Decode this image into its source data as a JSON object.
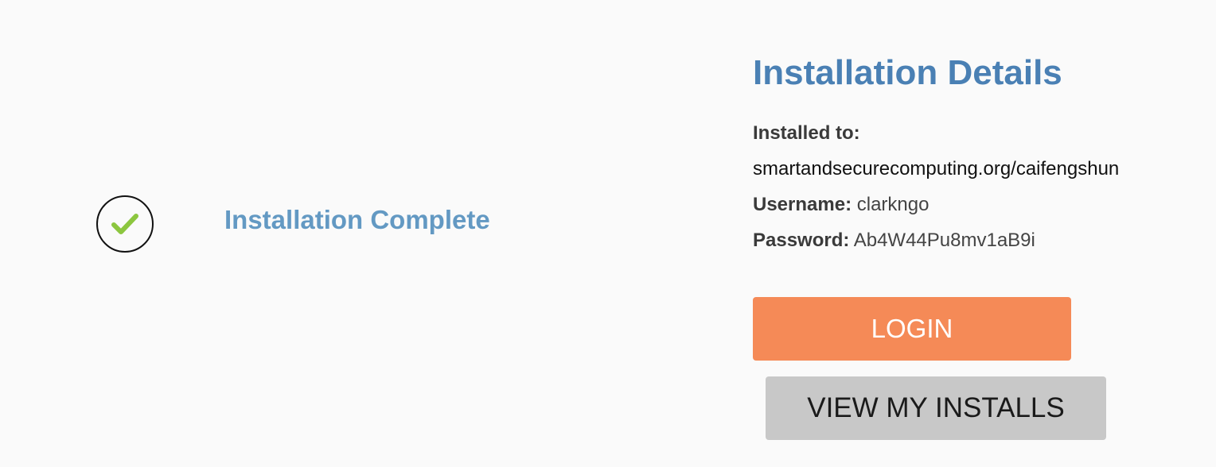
{
  "status": {
    "icon": "check-circle-icon",
    "title": "Installation Complete",
    "icon_color": "#8cc63f",
    "title_color": "#6399c3"
  },
  "details": {
    "title": "Installation Details",
    "installed_to_label": "Installed to:",
    "installed_to_value": "smartandsecurecomputing.org/caifengshun",
    "username_label": "Username:",
    "username_value": "clarkngo",
    "password_label": "Password:",
    "password_value": "Ab4W44Pu8mv1aB9i"
  },
  "actions": {
    "login_label": "LOGIN",
    "view_installs_label": "VIEW MY INSTALLS",
    "login_color": "#f58a57",
    "view_installs_color": "#c8c8c8"
  }
}
